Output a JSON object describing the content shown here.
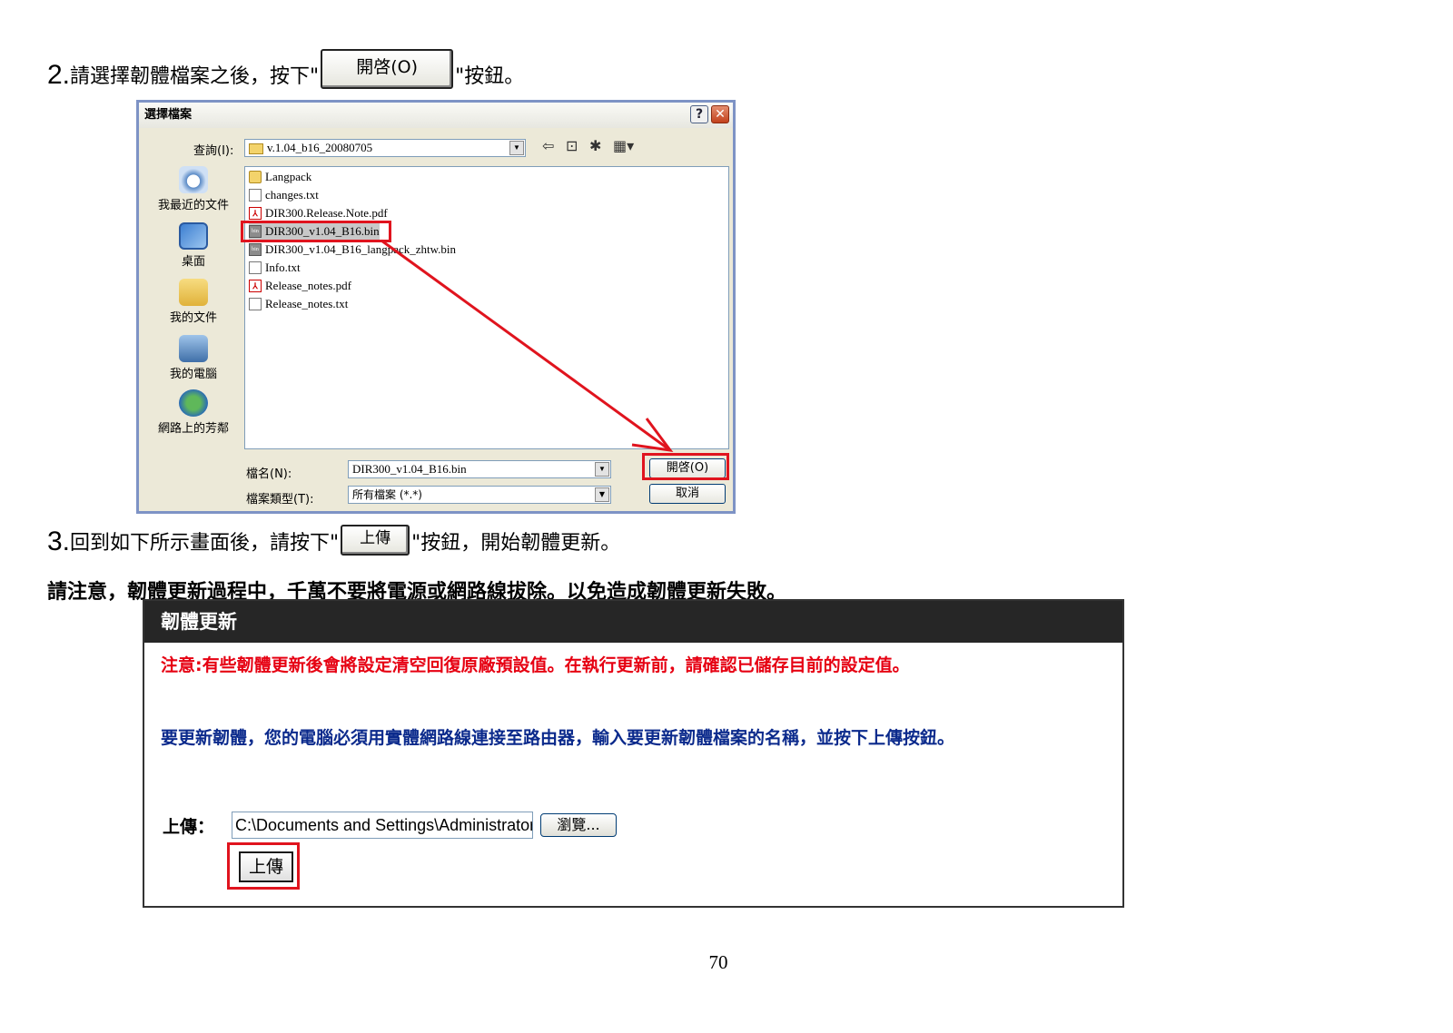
{
  "step2": {
    "number": "2.",
    "text_before": "請選擇韌體檔案之後，按下\"",
    "button_ref": "開啓(O)",
    "text_after": "\"按鈕。"
  },
  "dialog": {
    "title": "選擇檔案",
    "help_symbol": "?",
    "close_symbol": "✕",
    "lookin_label": "查詢(I):",
    "lookin_value": "v.1.04_b16_20080705",
    "places": [
      {
        "label": "我最近的文件",
        "icon": "recent-docs-icon"
      },
      {
        "label": "桌面",
        "icon": "desktop-icon"
      },
      {
        "label": "我的文件",
        "icon": "my-documents-icon"
      },
      {
        "label": "我的電腦",
        "icon": "my-computer-icon"
      },
      {
        "label": "網路上的芳鄰",
        "icon": "network-icon"
      }
    ],
    "files": [
      {
        "name": "Langpack",
        "type": "folder"
      },
      {
        "name": "changes.txt",
        "type": "txt"
      },
      {
        "name": "DIR300.Release.Note.pdf",
        "type": "pdf"
      },
      {
        "name": "DIR300_v1.04_B16.bin",
        "type": "bin",
        "highlighted": true
      },
      {
        "name": "DIR300_v1.04_B16_langpack_zhtw.bin",
        "type": "bin"
      },
      {
        "name": "Info.txt",
        "type": "txt"
      },
      {
        "name": "Release_notes.pdf",
        "type": "pdf"
      },
      {
        "name": "Release_notes.txt",
        "type": "txt"
      }
    ],
    "filename_label": "檔名(N):",
    "filename_value": "DIR300_v1.04_B16.bin",
    "filetype_label": "檔案類型(T):",
    "filetype_value": "所有檔案 (*.*)",
    "open_button": "開啓(O)",
    "cancel_button": "取消"
  },
  "step3": {
    "number": "3.",
    "text_before": "回到如下所示畫面後，請按下\"",
    "button_ref": "上傳",
    "text_after": "\"按鈕，開始韌體更新。"
  },
  "warning": "請注意，韌體更新過程中，千萬不要將電源或網路線拔除。以免造成韌體更新失敗。",
  "firmware": {
    "title": "韌體更新",
    "note_red": "注意:有些韌體更新後會將設定清空回復原廠預設值。在執行更新前，請確認已儲存目前的設定值。",
    "note_blue": "要更新韌體，您的電腦必須用實體網路線連接至路由器，輸入要更新韌體檔案的名稱，並按下上傳按鈕。",
    "upload_label": "上傳：",
    "upload_path": "C:\\Documents and Settings\\Administrator",
    "browse_button": "瀏覽...",
    "upload_button": "上傳"
  },
  "page_number": "70",
  "colors": {
    "highlight": "#e0141e",
    "warning_text": "#e60012",
    "info_text": "#0b2a8c"
  }
}
